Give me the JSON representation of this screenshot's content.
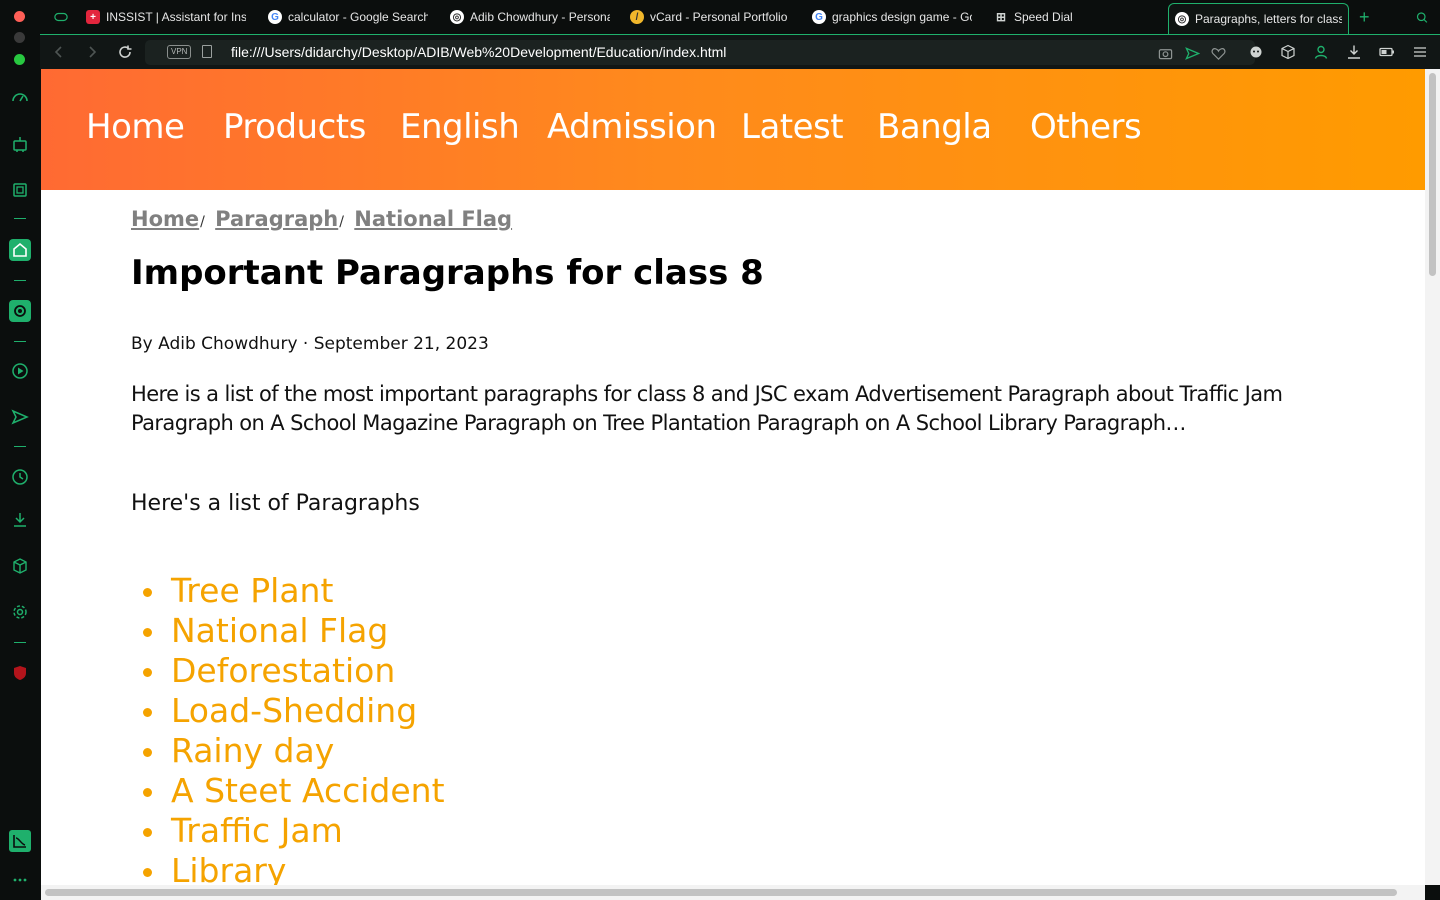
{
  "browser": {
    "tabs": [
      {
        "label": "INSSIST | Assistant for Insta",
        "icon": "inssist-icon",
        "active": false
      },
      {
        "label": "calculator - Google Search",
        "icon": "google-icon",
        "active": false
      },
      {
        "label": "Adib Chowdhury - Personal",
        "icon": "globe-icon",
        "active": false
      },
      {
        "label": "vCard - Personal Portfolio",
        "icon": "vcard-icon",
        "active": false
      },
      {
        "label": "graphics design game - Goo",
        "icon": "google-icon",
        "active": false
      },
      {
        "label": "Speed Dial",
        "icon": "grid-icon",
        "active": false
      },
      {
        "label": "Paragraphs, letters for class",
        "icon": "globe-icon",
        "active": true
      }
    ],
    "new_tab_symbol": "+",
    "address": {
      "vpn_label": "VPN",
      "url": "file:///Users/didarchy/Desktop/ADIB/Web%20Development/Education/index.html"
    },
    "accent_color": "#1fb06c"
  },
  "page": {
    "nav": [
      "Home",
      "Products",
      "English",
      "Admission",
      "Latest",
      "Bangla",
      "Others"
    ],
    "breadcrumb": [
      "Home",
      "Paragraph",
      "National Flag"
    ],
    "breadcrumb_separator": "/",
    "title": "Important Paragraphs for class 8",
    "byline": "By Adib Chowdhury · September 21, 2023",
    "intro": "Here is a list of the most important paragraphs for class 8 and JSC exam Advertisement Paragraph about Traffic Jam Paragraph on A School Magazine Paragraph on Tree Plantation Paragraph on A School Library Paragraph…",
    "list_heading": "Here's a list of Paragraphs",
    "paragraphs": [
      "Tree Plant",
      "National Flag",
      "Deforestation",
      "Load-Shedding",
      "Rainy day",
      "A Steet Accident",
      "Traffic Jam",
      "Library"
    ],
    "nav_gradient": [
      "#ff6a33",
      "#ff9b00"
    ],
    "link_color": "#f5a300"
  }
}
